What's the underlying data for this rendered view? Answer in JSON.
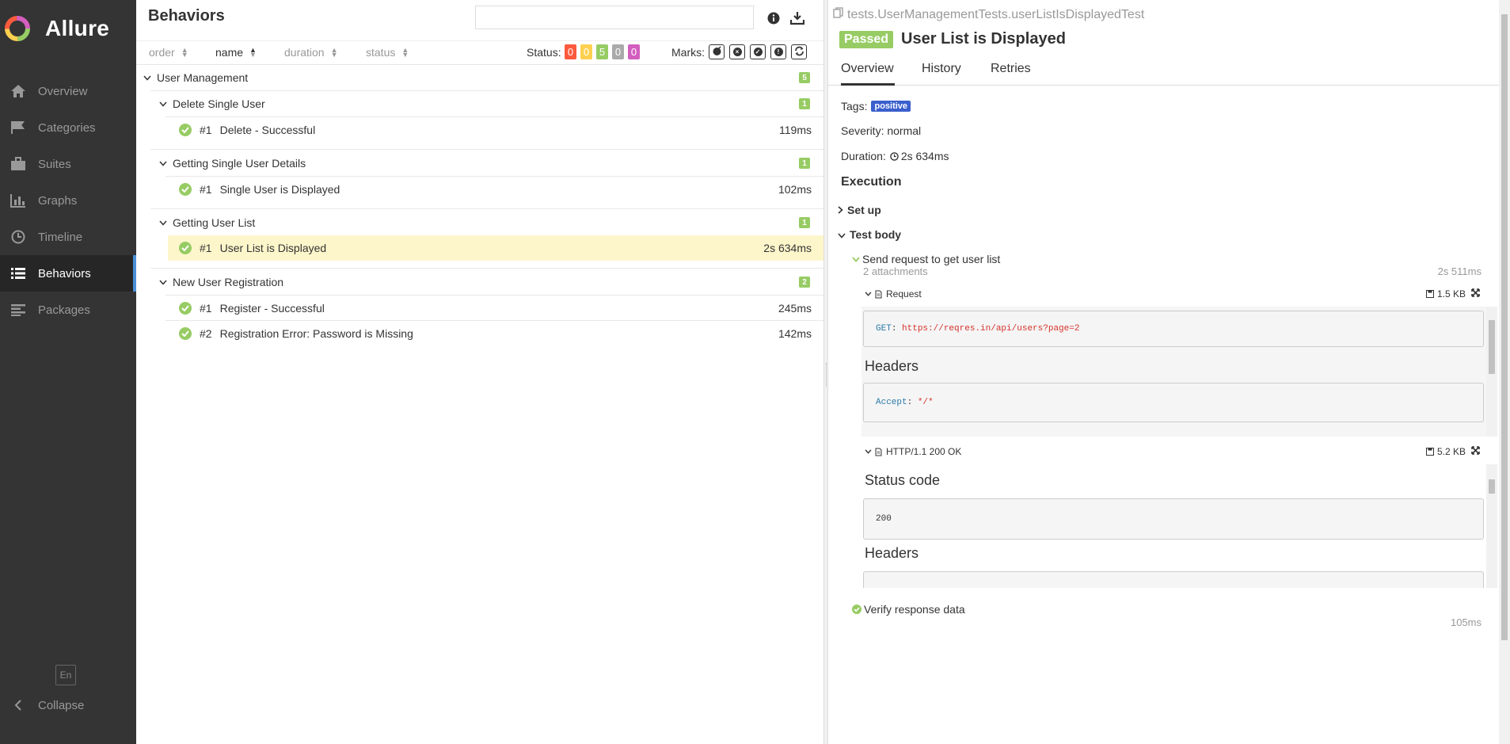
{
  "sidebar": {
    "brand": "Allure",
    "items": [
      {
        "label": "Overview",
        "icon": "home-icon"
      },
      {
        "label": "Categories",
        "icon": "flag-icon"
      },
      {
        "label": "Suites",
        "icon": "briefcase-icon"
      },
      {
        "label": "Graphs",
        "icon": "bar-chart-icon"
      },
      {
        "label": "Timeline",
        "icon": "clock-icon"
      },
      {
        "label": "Behaviors",
        "icon": "list-icon",
        "active": true
      },
      {
        "label": "Packages",
        "icon": "align-left-icon"
      }
    ],
    "language": "En",
    "collapse": "Collapse"
  },
  "behaviors": {
    "title": "Behaviors",
    "search_value": "",
    "sort": [
      {
        "label": "order"
      },
      {
        "label": "name",
        "active": true
      },
      {
        "label": "duration"
      },
      {
        "label": "status"
      }
    ],
    "status_label": "Status:",
    "status_counts": [
      {
        "value": "0",
        "color": "#fd5a3e"
      },
      {
        "value": "0",
        "color": "#ffd050"
      },
      {
        "value": "5",
        "color": "#97cc64"
      },
      {
        "value": "0",
        "color": "#aaaaaa"
      },
      {
        "value": "0",
        "color": "#d35ebe"
      }
    ],
    "marks_label": "Marks:",
    "marks": [
      "flaky-icon",
      "new-failed-icon",
      "new-passed-icon",
      "new-broken-icon",
      "retries-icon"
    ],
    "tree": {
      "root": {
        "name": "User Management",
        "count": "5"
      },
      "groups": [
        {
          "name": "Delete Single User",
          "count": "1",
          "tests": [
            {
              "num": "#1",
              "name": "Delete - Successful",
              "duration": "119ms"
            }
          ]
        },
        {
          "name": "Getting Single User Details",
          "count": "1",
          "tests": [
            {
              "num": "#1",
              "name": "Single User is Displayed",
              "duration": "102ms"
            }
          ]
        },
        {
          "name": "Getting User List",
          "count": "1",
          "tests": [
            {
              "num": "#1",
              "name": "User List is Displayed",
              "duration": "2s 634ms"
            }
          ]
        },
        {
          "name": "New User Registration",
          "count": "2",
          "tests": [
            {
              "num": "#1",
              "name": "Register - Successful",
              "duration": "245ms"
            },
            {
              "num": "#2",
              "name": "Registration Error: Password is Missing",
              "duration": "142ms"
            }
          ]
        }
      ]
    }
  },
  "detail": {
    "full_name": "tests.UserManagementTests.userListIsDisplayedTest",
    "status": "Passed",
    "status_color": "#97cc64",
    "title": "User List is Displayed",
    "tabs": [
      "Overview",
      "History",
      "Retries"
    ],
    "tags_label": "Tags:",
    "tag": "positive",
    "severity": "Severity: normal",
    "duration_label": "Duration:",
    "duration": "2s 634ms",
    "execution": "Execution",
    "setup": "Set up",
    "test_body": "Test body",
    "step1": {
      "name": "Send request to get user list",
      "sub": "2 attachments",
      "duration": "2s 511ms",
      "request": {
        "title": "Request",
        "size": "1.5 KB",
        "method_key": "GET",
        "url": "https://reqres.in/api/users?page=2",
        "headers_label": "Headers",
        "header_key": "Accept",
        "header_value": "*/*"
      },
      "response": {
        "title": "HTTP/1.1 200 OK",
        "size": "5.2 KB",
        "status_code_label": "Status code",
        "status_code": "200",
        "headers_label": "Headers"
      }
    },
    "step2": {
      "name": "Verify response data",
      "duration": "105ms"
    }
  }
}
